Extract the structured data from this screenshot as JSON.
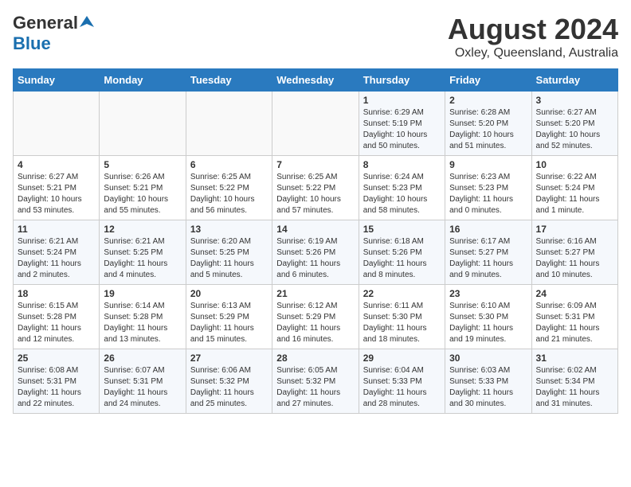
{
  "header": {
    "logo_general": "General",
    "logo_blue": "Blue",
    "month_title": "August 2024",
    "location": "Oxley, Queensland, Australia"
  },
  "weekdays": [
    "Sunday",
    "Monday",
    "Tuesday",
    "Wednesday",
    "Thursday",
    "Friday",
    "Saturday"
  ],
  "weeks": [
    [
      {
        "day": "",
        "info": ""
      },
      {
        "day": "",
        "info": ""
      },
      {
        "day": "",
        "info": ""
      },
      {
        "day": "",
        "info": ""
      },
      {
        "day": "1",
        "info": "Sunrise: 6:29 AM\nSunset: 5:19 PM\nDaylight: 10 hours\nand 50 minutes."
      },
      {
        "day": "2",
        "info": "Sunrise: 6:28 AM\nSunset: 5:20 PM\nDaylight: 10 hours\nand 51 minutes."
      },
      {
        "day": "3",
        "info": "Sunrise: 6:27 AM\nSunset: 5:20 PM\nDaylight: 10 hours\nand 52 minutes."
      }
    ],
    [
      {
        "day": "4",
        "info": "Sunrise: 6:27 AM\nSunset: 5:21 PM\nDaylight: 10 hours\nand 53 minutes."
      },
      {
        "day": "5",
        "info": "Sunrise: 6:26 AM\nSunset: 5:21 PM\nDaylight: 10 hours\nand 55 minutes."
      },
      {
        "day": "6",
        "info": "Sunrise: 6:25 AM\nSunset: 5:22 PM\nDaylight: 10 hours\nand 56 minutes."
      },
      {
        "day": "7",
        "info": "Sunrise: 6:25 AM\nSunset: 5:22 PM\nDaylight: 10 hours\nand 57 minutes."
      },
      {
        "day": "8",
        "info": "Sunrise: 6:24 AM\nSunset: 5:23 PM\nDaylight: 10 hours\nand 58 minutes."
      },
      {
        "day": "9",
        "info": "Sunrise: 6:23 AM\nSunset: 5:23 PM\nDaylight: 11 hours\nand 0 minutes."
      },
      {
        "day": "10",
        "info": "Sunrise: 6:22 AM\nSunset: 5:24 PM\nDaylight: 11 hours\nand 1 minute."
      }
    ],
    [
      {
        "day": "11",
        "info": "Sunrise: 6:21 AM\nSunset: 5:24 PM\nDaylight: 11 hours\nand 2 minutes."
      },
      {
        "day": "12",
        "info": "Sunrise: 6:21 AM\nSunset: 5:25 PM\nDaylight: 11 hours\nand 4 minutes."
      },
      {
        "day": "13",
        "info": "Sunrise: 6:20 AM\nSunset: 5:25 PM\nDaylight: 11 hours\nand 5 minutes."
      },
      {
        "day": "14",
        "info": "Sunrise: 6:19 AM\nSunset: 5:26 PM\nDaylight: 11 hours\nand 6 minutes."
      },
      {
        "day": "15",
        "info": "Sunrise: 6:18 AM\nSunset: 5:26 PM\nDaylight: 11 hours\nand 8 minutes."
      },
      {
        "day": "16",
        "info": "Sunrise: 6:17 AM\nSunset: 5:27 PM\nDaylight: 11 hours\nand 9 minutes."
      },
      {
        "day": "17",
        "info": "Sunrise: 6:16 AM\nSunset: 5:27 PM\nDaylight: 11 hours\nand 10 minutes."
      }
    ],
    [
      {
        "day": "18",
        "info": "Sunrise: 6:15 AM\nSunset: 5:28 PM\nDaylight: 11 hours\nand 12 minutes."
      },
      {
        "day": "19",
        "info": "Sunrise: 6:14 AM\nSunset: 5:28 PM\nDaylight: 11 hours\nand 13 minutes."
      },
      {
        "day": "20",
        "info": "Sunrise: 6:13 AM\nSunset: 5:29 PM\nDaylight: 11 hours\nand 15 minutes."
      },
      {
        "day": "21",
        "info": "Sunrise: 6:12 AM\nSunset: 5:29 PM\nDaylight: 11 hours\nand 16 minutes."
      },
      {
        "day": "22",
        "info": "Sunrise: 6:11 AM\nSunset: 5:30 PM\nDaylight: 11 hours\nand 18 minutes."
      },
      {
        "day": "23",
        "info": "Sunrise: 6:10 AM\nSunset: 5:30 PM\nDaylight: 11 hours\nand 19 minutes."
      },
      {
        "day": "24",
        "info": "Sunrise: 6:09 AM\nSunset: 5:31 PM\nDaylight: 11 hours\nand 21 minutes."
      }
    ],
    [
      {
        "day": "25",
        "info": "Sunrise: 6:08 AM\nSunset: 5:31 PM\nDaylight: 11 hours\nand 22 minutes."
      },
      {
        "day": "26",
        "info": "Sunrise: 6:07 AM\nSunset: 5:31 PM\nDaylight: 11 hours\nand 24 minutes."
      },
      {
        "day": "27",
        "info": "Sunrise: 6:06 AM\nSunset: 5:32 PM\nDaylight: 11 hours\nand 25 minutes."
      },
      {
        "day": "28",
        "info": "Sunrise: 6:05 AM\nSunset: 5:32 PM\nDaylight: 11 hours\nand 27 minutes."
      },
      {
        "day": "29",
        "info": "Sunrise: 6:04 AM\nSunset: 5:33 PM\nDaylight: 11 hours\nand 28 minutes."
      },
      {
        "day": "30",
        "info": "Sunrise: 6:03 AM\nSunset: 5:33 PM\nDaylight: 11 hours\nand 30 minutes."
      },
      {
        "day": "31",
        "info": "Sunrise: 6:02 AM\nSunset: 5:34 PM\nDaylight: 11 hours\nand 31 minutes."
      }
    ]
  ]
}
